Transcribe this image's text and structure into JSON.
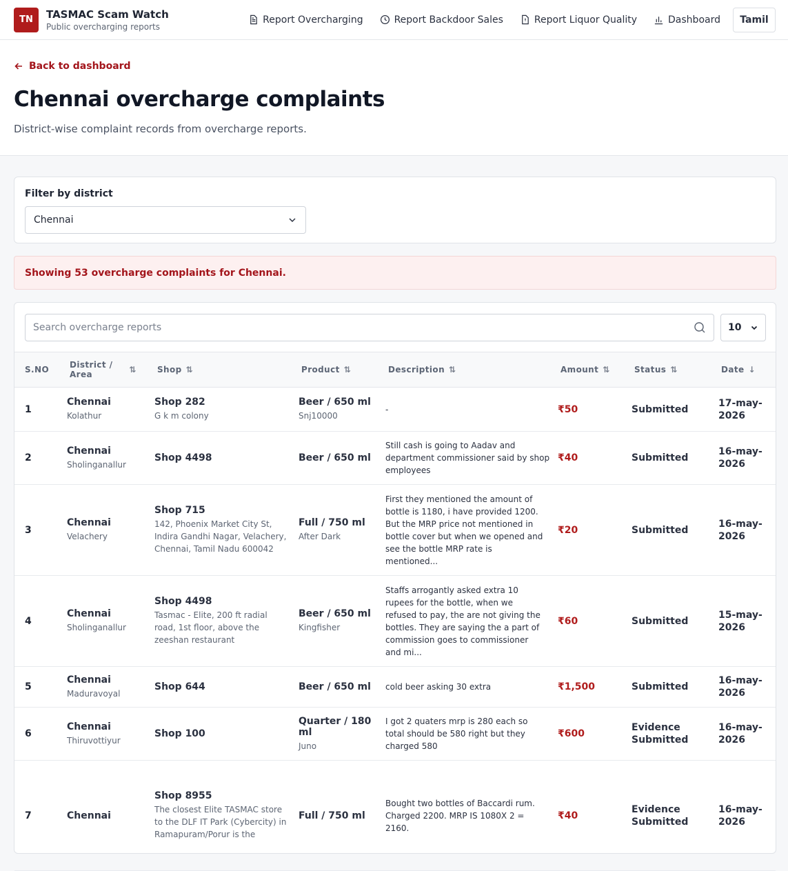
{
  "header": {
    "logo_text": "TN",
    "title": "TASMAC Scam Watch",
    "subtitle": "Public overcharging reports",
    "nav": [
      {
        "label": "Report Overcharging",
        "icon": "document-icon"
      },
      {
        "label": "Report Backdoor Sales",
        "icon": "clock-icon"
      },
      {
        "label": "Report Liquor Quality",
        "icon": "alert-document-icon"
      },
      {
        "label": "Dashboard",
        "icon": "bar-chart-icon"
      }
    ],
    "language_button": "Tamil"
  },
  "hero": {
    "back_link": "Back to dashboard",
    "title": "Chennai overcharge complaints",
    "subtitle": "District-wise complaint records from overcharge reports."
  },
  "filter": {
    "label": "Filter by district",
    "selected": "Chennai"
  },
  "notice": "Showing 53 overcharge complaints for Chennai.",
  "table": {
    "search_placeholder": "Search overcharge reports",
    "page_size": "10",
    "columns": {
      "sno": "S.NO",
      "district_1": "District /",
      "district_2": "Area",
      "shop": "Shop",
      "product": "Product",
      "description": "Description",
      "amount": "Amount",
      "status": "Status",
      "date": "Date"
    },
    "rows": [
      {
        "sno": "1",
        "district": "Chennai",
        "area": "Kolathur",
        "shop": "Shop 282",
        "shop_detail": "G k m colony",
        "product": "Beer / 650 ml",
        "brand": "Snj10000",
        "description": "-",
        "amount": "₹50",
        "status": "Submitted",
        "date": "17-may-2026"
      },
      {
        "sno": "2",
        "district": "Chennai",
        "area": "Sholinganallur",
        "shop": "Shop 4498",
        "shop_detail": "",
        "product": "Beer / 650 ml",
        "brand": "",
        "description": "Still cash is going to Aadav and department commissioner said by shop employees",
        "amount": "₹40",
        "status": "Submitted",
        "date": "16-may-2026"
      },
      {
        "sno": "3",
        "district": "Chennai",
        "area": "Velachery",
        "shop": "Shop 715",
        "shop_detail": "142, Phoenix Market City St, Indira Gandhi Nagar, Velachery, Chennai, Tamil Nadu 600042",
        "product": "Full / 750 ml",
        "brand": "After Dark",
        "description": "First they mentioned the amount of bottle is 1180, i have provided 1200. But the MRP price not mentioned in bottle cover but when we opened and see the bottle MRP rate is mentioned...",
        "amount": "₹20",
        "status": "Submitted",
        "date": "16-may-2026"
      },
      {
        "sno": "4",
        "district": "Chennai",
        "area": "Sholinganallur",
        "shop": "Shop 4498",
        "shop_detail": "Tasmac - Elite, 200 ft radial road, 1st floor, above the zeeshan restaurant",
        "product": "Beer / 650 ml",
        "brand": "Kingfisher",
        "description": "Staffs arrogantly asked extra 10 rupees for the bottle, when we refused to pay, the are not giving the bottles. They are saying the a part of commission goes to commissioner and mi...",
        "amount": "₹60",
        "status": "Submitted",
        "date": "15-may-2026"
      },
      {
        "sno": "5",
        "district": "Chennai",
        "area": "Maduravoyal",
        "shop": "Shop 644",
        "shop_detail": "",
        "product": "Beer / 650 ml",
        "brand": "",
        "description": "cold beer asking 30 extra",
        "amount": "₹1,500",
        "status": "Submitted",
        "date": "16-may-2026"
      },
      {
        "sno": "6",
        "district": "Chennai",
        "area": "Thiruvottiyur",
        "shop": "Shop 100",
        "shop_detail": "",
        "product": "Quarter / 180 ml",
        "brand": "Juno",
        "description": "I got 2 quaters mrp is 280 each so total should be 580 right but they charged 580",
        "amount": "₹600",
        "status": "Evidence Submitted",
        "date": "16-may-2026"
      },
      {
        "sno": "7",
        "district": "Chennai",
        "area": "",
        "shop": "Shop 8955",
        "shop_detail": "The closest Elite TASMAC store to the DLF IT Park (Cybercity) in Ramapuram/Porur is the",
        "product": "Full / 750 ml",
        "brand": "",
        "description": "Bought two bottles of Baccardi rum. Charged 2200. MRP IS 1080X 2 = 2160.",
        "amount": "₹40",
        "status": "Evidence Submitted",
        "date": "16-may-2026"
      }
    ]
  }
}
